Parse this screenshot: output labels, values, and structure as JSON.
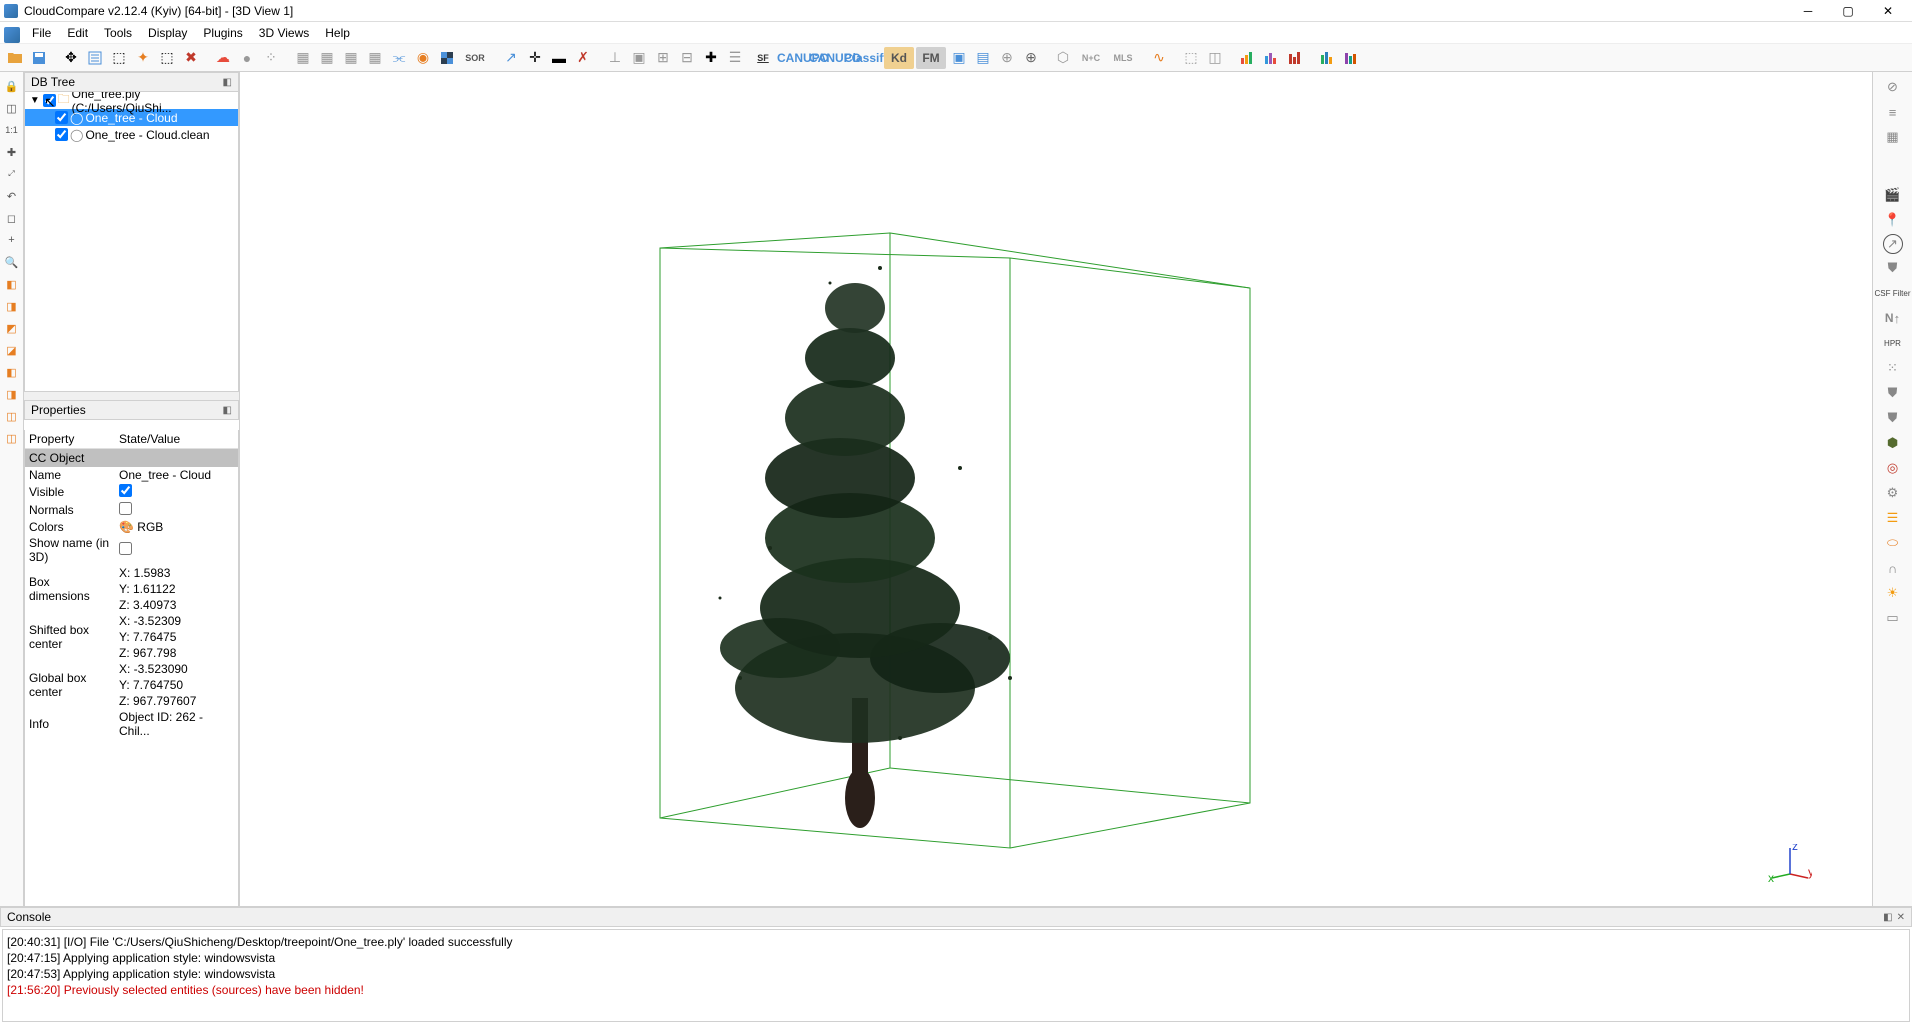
{
  "title": "CloudCompare v2.12.4 (Kyiv) [64-bit] - [3D View 1]",
  "menu": {
    "file": "File",
    "edit": "Edit",
    "tools": "Tools",
    "display": "Display",
    "plugins": "Plugins",
    "views": "3D Views",
    "help": "Help"
  },
  "toolbar_text": {
    "sor": "SOR",
    "sf": "SF",
    "kd": "Kd",
    "fm": "FM",
    "nc": "N+C",
    "mls": "MLS",
    "canupo1": "CANUPO",
    "canupo2": "CANUPO",
    "classify": "Classify"
  },
  "dbtree": {
    "title": "DB Tree",
    "root": "One_tree.ply (C:/Users/QiuShi...",
    "child1": "One_tree - Cloud",
    "child2": "One_tree - Cloud.clean"
  },
  "properties": {
    "title": "Properties",
    "col1": "Property",
    "col2": "State/Value",
    "section1": "CC Object",
    "name_k": "Name",
    "name_v": "One_tree - Cloud",
    "visible_k": "Visible",
    "normals_k": "Normals",
    "colors_k": "Colors",
    "colors_v": "RGB",
    "showname_k": "Show name (in 3D)",
    "boxdim_k": "Box dimensions",
    "boxdim_x": "X: 1.5983",
    "boxdim_y": "Y: 1.61122",
    "boxdim_z": "Z: 3.40973",
    "shifted_k": "Shifted box center",
    "shifted_x": "X: -3.52309",
    "shifted_y": "Y: 7.76475",
    "shifted_z": "Z: 967.798",
    "global_k": "Global box center",
    "global_x": "X: -3.523090",
    "global_y": "Y: 7.764750",
    "global_z": "Z: 967.797607",
    "info_k": "Info",
    "info_v": "Object ID: 262 - Chil..."
  },
  "console": {
    "title": "Console",
    "l1": "[20:40:31] [I/O] File 'C:/Users/QiuShicheng/Desktop/treepoint/One_tree.ply' loaded successfully",
    "l2": "[20:47:15] Applying application style: windowsvista",
    "l3": "[20:47:53] Applying application style: windowsvista",
    "l4": "[21:56:20] Previously selected entities (sources) have been hidden!"
  },
  "right_labels": {
    "csf": "CSF Filter",
    "n": "N",
    "hpr": "HPR"
  }
}
